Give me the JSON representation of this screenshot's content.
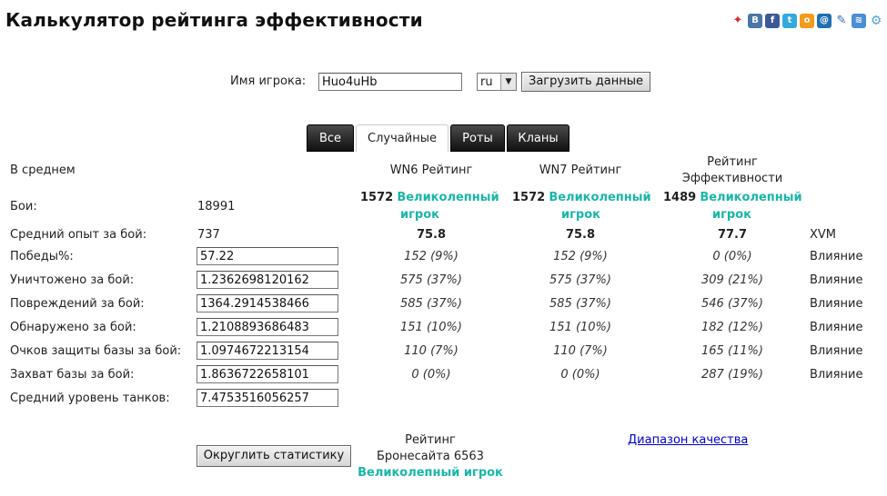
{
  "page": {
    "title": "Калькулятор рейтинга эффективности"
  },
  "social": [
    {
      "name": "share-runner-icon",
      "glyph": "✦",
      "color": "#d42f2f"
    },
    {
      "name": "vk-icon",
      "glyph": "B",
      "color": "#4a76a8"
    },
    {
      "name": "facebook-icon",
      "glyph": "f",
      "color": "#3b5998"
    },
    {
      "name": "twitter-icon",
      "glyph": "t",
      "color": "#33aadd"
    },
    {
      "name": "odnoklassniki-icon",
      "glyph": "o",
      "color": "#f59a1a"
    },
    {
      "name": "mail-icon",
      "glyph": "@",
      "color": "#1f6fb2"
    },
    {
      "name": "livejournal-icon",
      "glyph": "✎",
      "color": "#2a6fb6"
    },
    {
      "name": "liveinternet-icon",
      "glyph": "≋",
      "color": "#4a8fd6"
    },
    {
      "name": "settings-icon",
      "glyph": "⚙",
      "color": "#5aa0d6"
    }
  ],
  "search": {
    "player_label": "Имя игрока:",
    "player_value": "Huo4uHb",
    "region_value": "ru",
    "load_button": "Загрузить данные"
  },
  "tabs": [
    {
      "label": "Все",
      "active": false
    },
    {
      "label": "Случайные",
      "active": true
    },
    {
      "label": "Роты",
      "active": false
    },
    {
      "label": "Кланы",
      "active": false
    }
  ],
  "table": {
    "avg_label": "В среднем",
    "col_wn6": "WN6 Рейтинг",
    "col_wn7": "WN7 Рейтинг",
    "col_eff_1": "Рейтинг",
    "col_eff_2": "Эффективности",
    "battles_label": "Бои:",
    "battles_value": "18991",
    "wn6_score": "1572",
    "wn6_rank_1": "Великолепный",
    "wn6_rank_2": "игрок",
    "wn7_score": "1572",
    "wn7_rank_1": "Великолепный",
    "wn7_rank_2": "игрок",
    "eff_score": "1489",
    "eff_rank_1": "Великолепный",
    "eff_rank_2": "игрок",
    "avgxp_label": "Средний опыт за бой:",
    "avgxp_value": "737",
    "wn6_pct": "75.8",
    "wn7_pct": "75.8",
    "eff_pct": "77.7",
    "xvm": "XVM",
    "rows": [
      {
        "label": "Победы%:",
        "value": "57.22",
        "wn6": "152 (9%)",
        "wn7": "152 (9%)",
        "eff": "0 (0%)",
        "influence": "Влияние"
      },
      {
        "label": "Уничтожено за бой:",
        "value": "1.2362698120162",
        "wn6": "575 (37%)",
        "wn7": "575 (37%)",
        "eff": "309 (21%)",
        "influence": "Влияние"
      },
      {
        "label": "Повреждений за бой:",
        "value": "1364.2914538466",
        "wn6": "585 (37%)",
        "wn7": "585 (37%)",
        "eff": "546 (37%)",
        "influence": "Влияние"
      },
      {
        "label": "Обнаружено за бой:",
        "value": "1.2108893686483",
        "wn6": "151 (10%)",
        "wn7": "151 (10%)",
        "eff": "182 (12%)",
        "influence": "Влияние"
      },
      {
        "label": "Очков защиты базы за бой:",
        "value": "1.0974672213154",
        "wn6": "110 (7%)",
        "wn7": "110 (7%)",
        "eff": "165 (11%)",
        "influence": "Влияние"
      },
      {
        "label": "Захват базы за бой:",
        "value": "1.8636722658101",
        "wn6": "0 (0%)",
        "wn7": "0 (0%)",
        "eff": "287 (19%)",
        "influence": "Влияние"
      }
    ],
    "tier_label": "Средний уровень танков:",
    "tier_value": "7.4753516056257"
  },
  "footer": {
    "round_button": "Округлить статистику",
    "armor_1": "Рейтинг",
    "armor_2": "Бронесайта 6563",
    "armor_rank": "Великолепный игрок",
    "quality_link": "Диапазон качества"
  }
}
